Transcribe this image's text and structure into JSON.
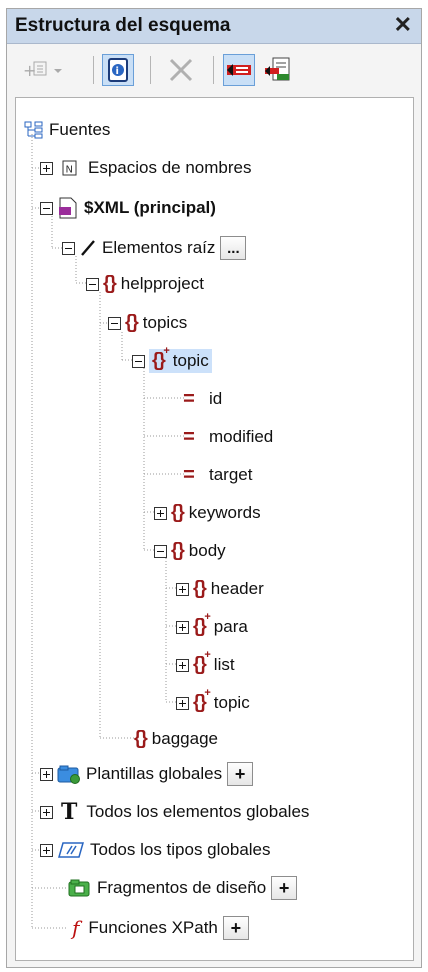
{
  "panel": {
    "title": "Estructura del esquema",
    "close_glyph": "✕"
  },
  "toolbar": {
    "buttons": [
      "add-element-icon",
      "schema-info-icon",
      "delete-icon",
      "highlight-icon",
      "import-icon"
    ]
  },
  "tree": {
    "root_label": "Fuentes",
    "namespaces_label": "Espacios de nombres",
    "xml_label": "$XML (principal)",
    "root_elements_label": "Elementos raíz",
    "root_elements_btn": "...",
    "helpproject": "helpproject",
    "topics": "topics",
    "topic": "topic",
    "attr_id": "id",
    "attr_modified": "modified",
    "attr_target": "target",
    "keywords": "keywords",
    "body": "body",
    "header": "header",
    "para": "para",
    "list": "list",
    "topic_child": "topic",
    "baggage": "baggage",
    "global_templates": "Plantillas globales",
    "all_global_elements": "Todos los elementos globales",
    "all_global_types": "Todos los tipos globales",
    "design_fragments": "Fragmentos de diseño",
    "xpath_functions": "Funciones XPath",
    "plus_btn": "+"
  }
}
